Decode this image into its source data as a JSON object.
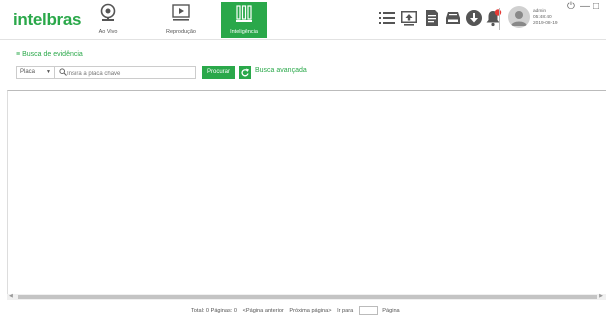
{
  "app": {
    "logo": "intelbras"
  },
  "nav": [
    {
      "label": "Ao Vivo",
      "icon": "webcam-icon"
    },
    {
      "label": "Reprodução",
      "icon": "playback-monitor-icon"
    },
    {
      "label": "Inteligência",
      "icon": "intelligence-icon",
      "active": true
    }
  ],
  "toolbar": {
    "icons": [
      "list-icon",
      "upload-screen-icon",
      "document-icon",
      "storage-icon",
      "download-icon",
      "alarm-bell-icon"
    ],
    "alarm_badge": "6"
  },
  "user": {
    "name": "admin",
    "time": "05:48:40",
    "date": "2019-08-19"
  },
  "window_controls": {
    "power": "⏻",
    "minimize": "—",
    "maximize": "□"
  },
  "panel": {
    "title": "Busca de evidência",
    "filter": {
      "selected": "Placa"
    },
    "search": {
      "placeholder": "Insira a placa chave",
      "value": ""
    },
    "search_button": "Procurar",
    "advanced_link": "Busca avançada"
  },
  "pagination": {
    "total": "Total: 0 Páginas: 0",
    "prev": "<Página anterior",
    "next": "Próxima página>",
    "goto_label": "Ir para",
    "page_label": "Página",
    "goto_value": ""
  },
  "colors": {
    "accent": "#2aa84a",
    "alarm": "#e53935"
  }
}
